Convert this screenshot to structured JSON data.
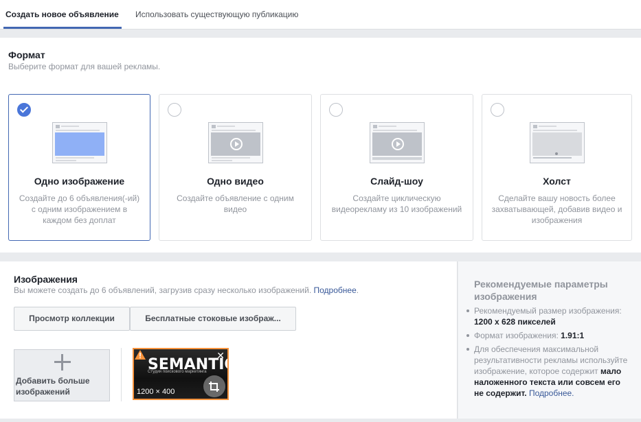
{
  "tabs": {
    "create_new": "Создать новое объявление",
    "use_existing": "Использовать существующую публикацию"
  },
  "format": {
    "title": "Формат",
    "subtitle": "Выберите формат для вашей рекламы.",
    "cards": [
      {
        "title": "Одно изображение",
        "desc": "Создайте до 6 объявления(-ий) с одним изображением в каждом без доплат",
        "selected": true
      },
      {
        "title": "Одно видео",
        "desc": "Создайте объявление с одним видео",
        "selected": false
      },
      {
        "title": "Слайд-шоу",
        "desc": "Создайте циклическую видеорекламу из 10 изображений",
        "selected": false
      },
      {
        "title": "Холст",
        "desc": "Сделайте вашу новость более захватывающей, добавив видео и изображения",
        "selected": false
      }
    ]
  },
  "images": {
    "title": "Изображения",
    "subtitle": "Вы можете создать до 6 объявлений, загрузив сразу несколько изображений.",
    "learn_more": "Подробнее",
    "period": ".",
    "browse_library": "Просмотр коллекции",
    "free_stock": "Бесплатные стоковые изображ...",
    "add_more": "Добавить больше изображений",
    "thumb": {
      "brand": "SEMANTICA",
      "tagline": "Студия поискового маркетинга",
      "size": "1200 × 400"
    }
  },
  "recommendations": {
    "title": "Рекомендуемые параметры изображения",
    "size_label": "Рекомендуемый размер изображения:",
    "size_value": "1200 x 628 пикселей",
    "ratio_label": "Формат изображения:",
    "ratio_value": "1.91:1",
    "tip_text": "Для обеспечения максимальной результативности рекламы используйте изображение, которое содержит",
    "tip_bold": "мало наложенного текста или совсем его не содержит.",
    "learn_more": "Подробнее."
  },
  "colors": {
    "accent": "#4267b2",
    "selected_radio": "#4a76d9",
    "warning_border": "#f7923b",
    "link": "#385898"
  }
}
